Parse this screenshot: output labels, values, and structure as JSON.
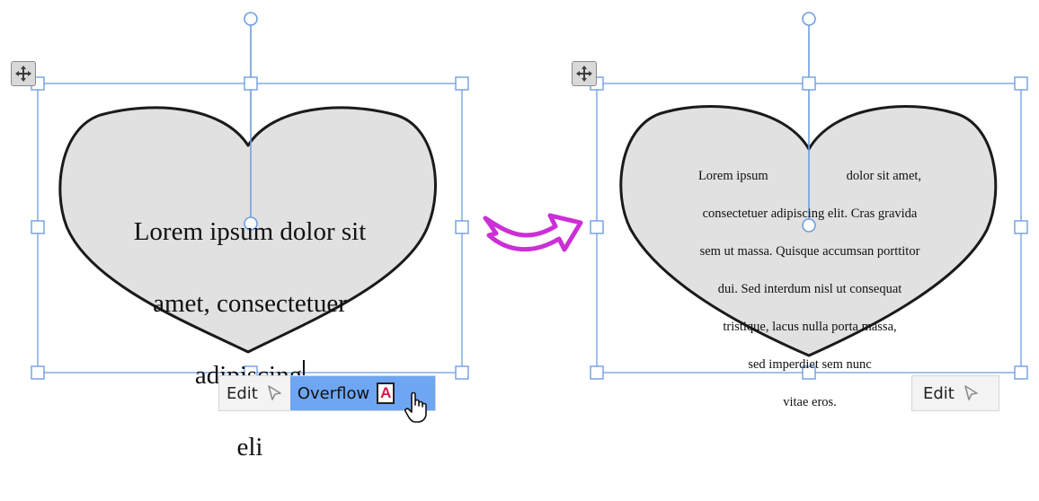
{
  "left_frame": {
    "text_lines": [
      "Lorem ipsum dolor sit",
      "amet, consectetuer",
      "adipiscing",
      "eli"
    ],
    "toolbar": {
      "edit_label": "Edit",
      "overflow_label": "Overflow",
      "overflow_icon_glyph": "A",
      "overflow_active_color": "#6fa6f4"
    }
  },
  "right_frame": {
    "text_lines": [
      "Lorem ipsum                        dolor sit amet,",
      "consectetuer adipiscing elit. Cras gravida",
      "sem ut massa. Quisque accumsan porttitor",
      "dui. Sed interdum nisl ut consequat",
      "tristique, lacus nulla porta massa,",
      "sed imperdiet sem nunc",
      "vitae eros."
    ],
    "toolbar": {
      "edit_label": "Edit"
    }
  },
  "colors": {
    "selection_blue": "#6f9fe0",
    "heart_fill": "#e1e1e1",
    "transition_arrow": "#cc2fd6"
  },
  "icons": {
    "move_handle": "move-arrows-icon",
    "rotate_handle": "rotate-handle-icon",
    "edit_arrow": "select-arrow-icon",
    "overflow": "text-overflow-icon",
    "cursor": "hand-pointer-icon",
    "transition": "curved-arrow-icon"
  }
}
